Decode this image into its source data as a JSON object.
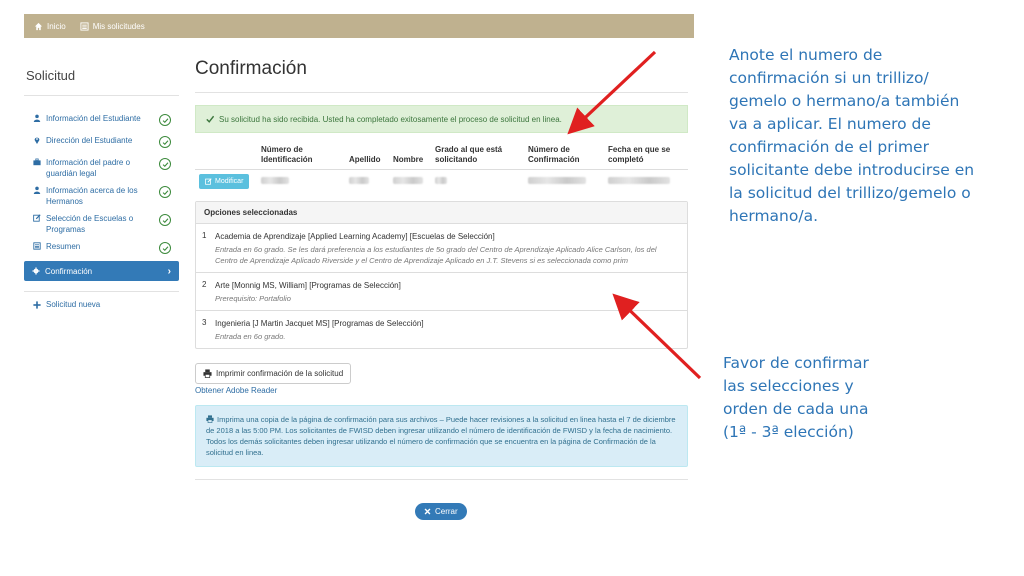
{
  "topbar": {
    "home_label": "Inicio",
    "requests_label": "Mis solicitudes"
  },
  "sidebar": {
    "title": "Solicitud",
    "items": [
      {
        "label": "Información del Estudiante",
        "icon": "user-icon",
        "completed": true
      },
      {
        "label": "Dirección del Estudiante",
        "icon": "map-marker-icon",
        "completed": true
      },
      {
        "label": "Información del padre o guardián legal",
        "icon": "briefcase-icon",
        "completed": true
      },
      {
        "label": "Información acerca de los Hermanos",
        "icon": "user-icon",
        "completed": true
      },
      {
        "label": "Selección de Escuelas o Programas",
        "icon": "edit-icon",
        "completed": true
      },
      {
        "label": "Resumen",
        "icon": "list-icon",
        "completed": true
      },
      {
        "label": "Confirmación",
        "icon": "gear-icon",
        "active": true
      }
    ],
    "new_request_label": "Solicitud nueva"
  },
  "main": {
    "title": "Confirmación",
    "success_message": "Su solicitud ha sido recibida. Usted ha completado exitosamente el proceso de solicitud en linea.",
    "table": {
      "headers": [
        "Número de Identificación",
        "Apellido",
        "Nombre",
        "Grado al que está solicitando",
        "Número de Confirmación",
        "Fecha en que se completó"
      ],
      "modify_label": "Modificar"
    },
    "options": {
      "heading": "Opciones seleccionadas",
      "items": [
        {
          "num": "1",
          "name": "Academia de Aprendizaje [Applied Learning Academy] [Escuelas de Selección]",
          "desc": "Entrada en 6o grado. Se les dará preferencia a los estudiantes de 5o grado del Centro de Aprendizaje Aplicado Alice Carlson, los del Centro de Aprendizaje Aplicado Riverside y el Centro de Aprendizaje Aplicado en J.T. Stevens si es seleccionada como prim"
        },
        {
          "num": "2",
          "name": "Arte [Monnig MS, William] [Programas de Selección]",
          "desc": "Prerequisito: Portafolio"
        },
        {
          "num": "3",
          "name": "Ingenieria [J Martin Jacquet MS] [Programas de Selección]",
          "desc": "Entrada en 6o grado."
        }
      ]
    },
    "print_label": "Imprimir confirmación de la solicitud",
    "adobe_label": "Obtener Adobe Reader",
    "info_message": "Imprima una copia de la página de confirmación para sus archivos – Puede hacer revisiones a la solicitud en linea hasta el 7 de diciembre de 2018 a las 5:00 PM. Los solicitantes de FWISD deben ingresar utilizando el número de identificación de FWISD y la fecha de nacimiento. Todos los demás solicitantes deben ingresar utilizando el número de confirmación que se encuentra en la página de Confirmación de la solicitud en linea.",
    "close_label": "Cerrar"
  },
  "annotations": {
    "note_confirmation": "Anote el numero de confirmación si un trillizo/ gemelo o hermano/a también va a aplicar. El numero de confirmación de el primer solicitante debe introducirse en la solicitud del trillizo/gemelo o hermano/a.",
    "note_selections": "Favor de confirmar las selecciones y orden de cada una (1ª - 3ª elección)",
    "arrow_color": "#e02020",
    "text_color": "#2e75b6"
  },
  "colors": {
    "topbar": "#bfb18f",
    "primary": "#337ab7",
    "success_bg": "#dff0d8",
    "info_bg": "#d9edf7"
  }
}
